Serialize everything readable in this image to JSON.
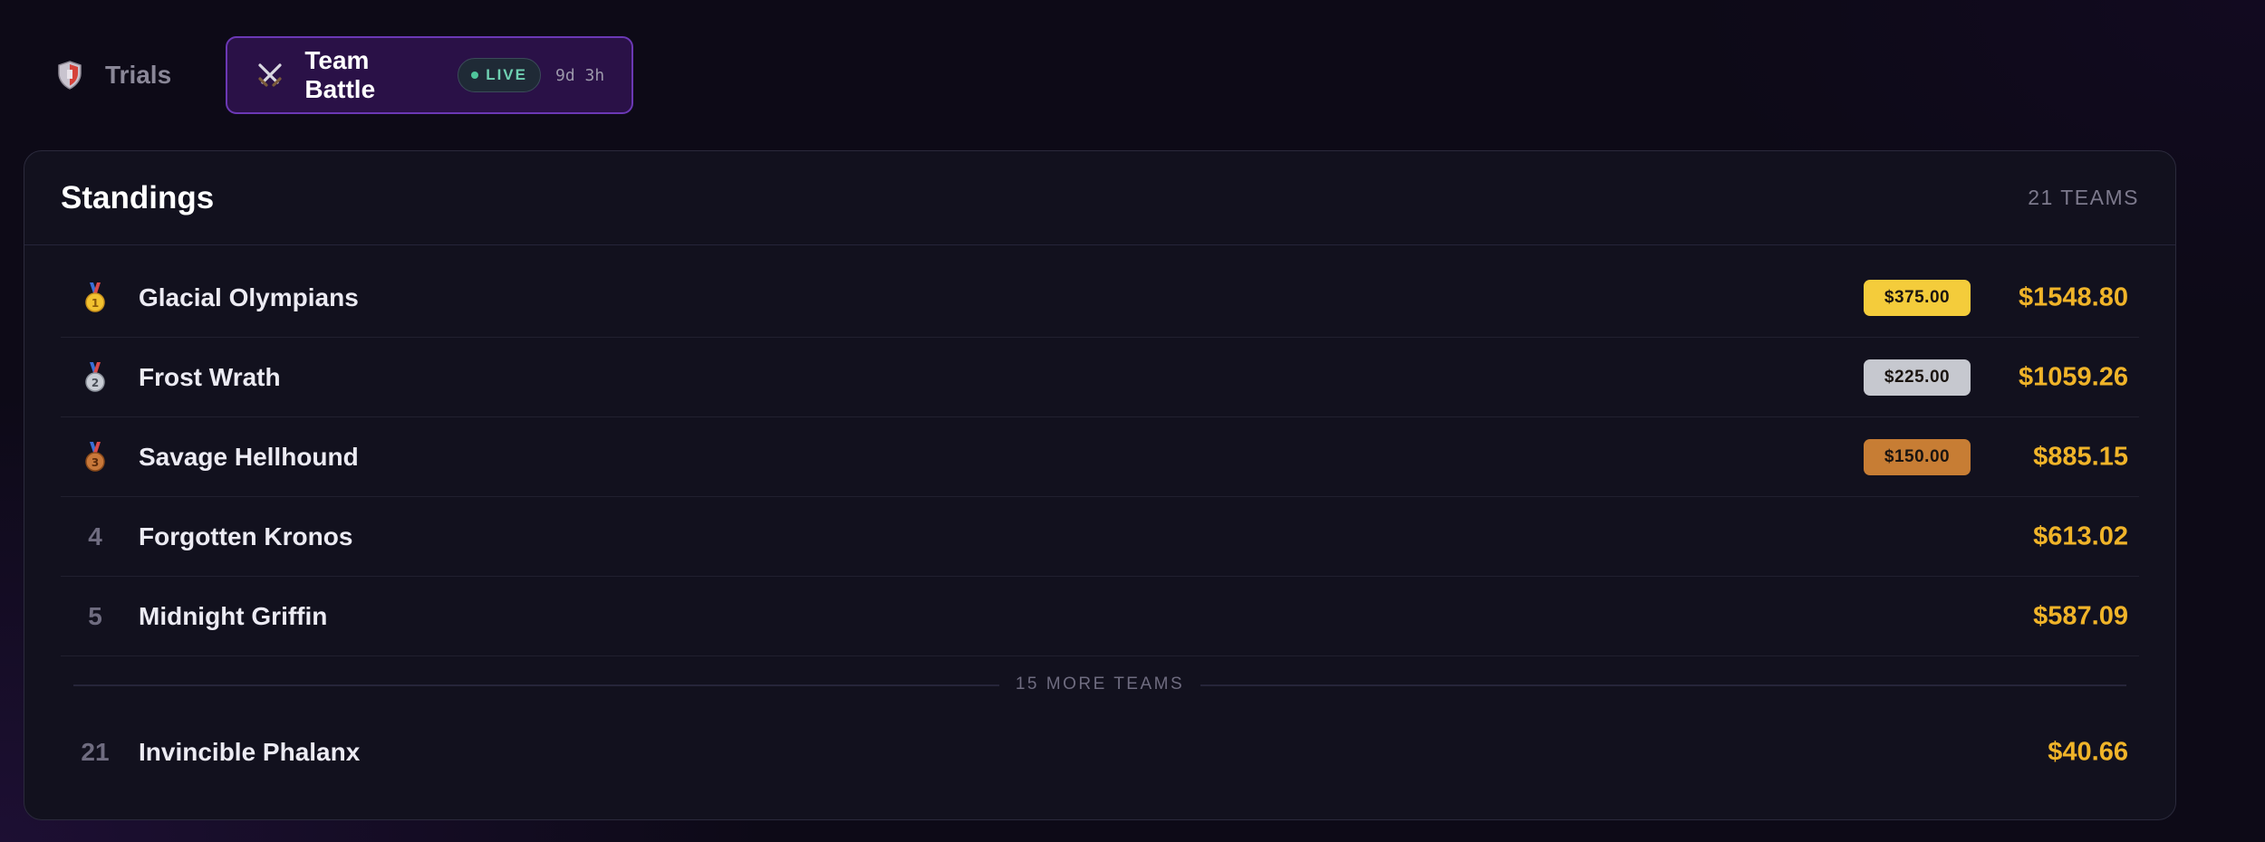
{
  "tabs": [
    {
      "label": "Trials",
      "icon": "shield-icon",
      "active": false
    },
    {
      "label": "Team Battle",
      "icon": "crossed-swords-icon",
      "active": true,
      "badge": "LIVE",
      "timer": "9d 3h"
    }
  ],
  "standings": {
    "title": "Standings",
    "count_label": "21 TEAMS",
    "more_label": "15 MORE TEAMS",
    "rows": [
      {
        "rank": "1",
        "medal": "gold-medal-icon",
        "name": "Glacial Olympians",
        "prize": "$375.00",
        "amount": "$1548.80"
      },
      {
        "rank": "2",
        "medal": "silver-medal-icon",
        "name": "Frost Wrath",
        "prize": "$225.00",
        "amount": "$1059.26"
      },
      {
        "rank": "3",
        "medal": "bronze-medal-icon",
        "name": "Savage Hellhound",
        "prize": "$150.00",
        "amount": "$885.15"
      },
      {
        "rank": "4",
        "name": "Forgotten Kronos",
        "amount": "$613.02"
      },
      {
        "rank": "5",
        "name": "Midnight Griffin",
        "amount": "$587.09"
      }
    ],
    "last_row": {
      "rank": "21",
      "name": "Invincible Phalanx",
      "amount": "$40.66"
    }
  },
  "colors": {
    "accent_purple": "#6b38b5",
    "gold": "#f4cc3b",
    "silver": "#c6c8cf",
    "bronze": "#c77d34",
    "amount": "#f0b429",
    "live_green": "#4fc59b"
  }
}
